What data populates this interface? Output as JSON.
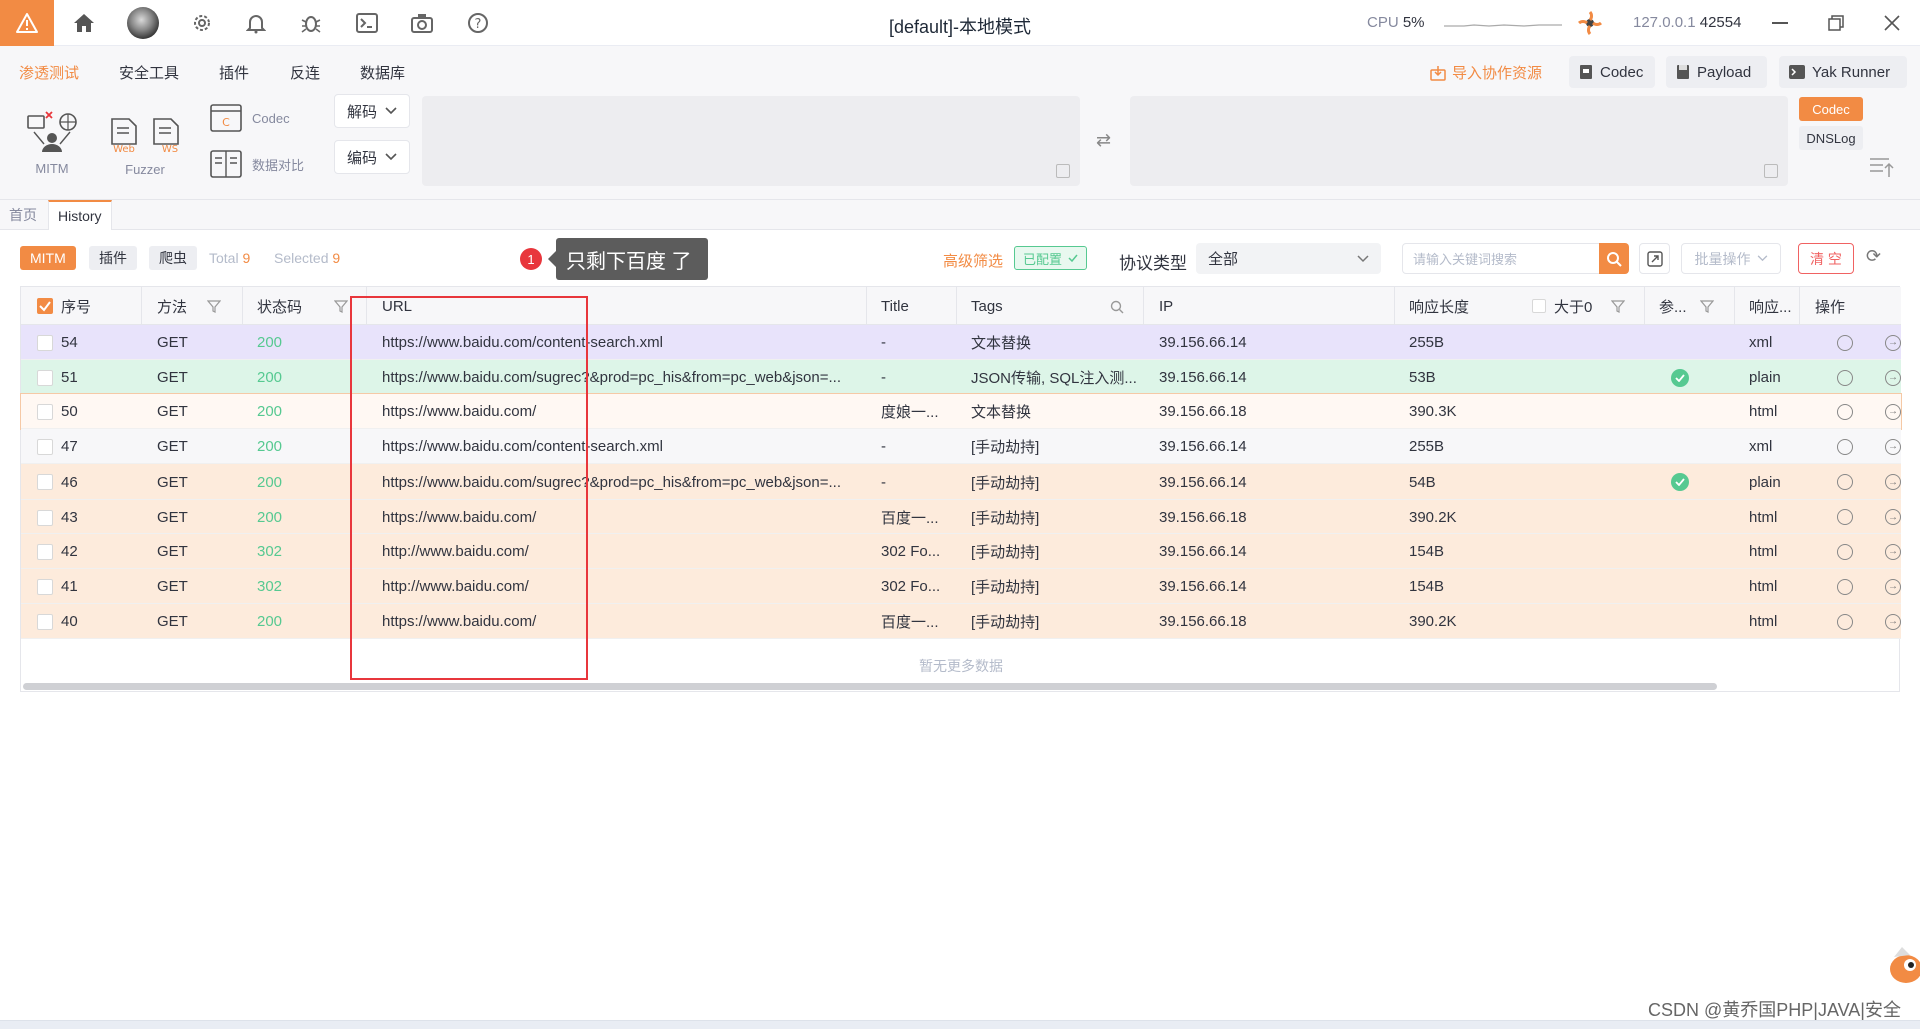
{
  "window": {
    "title": "[default]-本地模式",
    "cpu_label": "CPU",
    "cpu_value": "5%",
    "host": "127.0.0.1",
    "port": "42554"
  },
  "menu": {
    "items": [
      "渗透测试",
      "安全工具",
      "插件",
      "反连",
      "数据库"
    ],
    "active_index": 0,
    "import_label": "导入协作资源",
    "right_buttons": [
      "Codec",
      "Payload",
      "Yak Runner"
    ]
  },
  "toolbar": {
    "mitm_label": "MITM",
    "fuzzer_label": "Fuzzer",
    "fuzzer_web": "Web",
    "fuzzer_ws": "WS",
    "codec_label": "Codec",
    "diff_label": "数据对比",
    "decode_label": "解码",
    "encode_label": "编码",
    "side_codec": "Codec",
    "side_dnslog": "DNSLog"
  },
  "tabs": [
    "首页",
    "History"
  ],
  "filter": {
    "chips": [
      "MITM",
      "插件",
      "爬虫"
    ],
    "total_label": "Total",
    "total_value": "9",
    "selected_label": "Selected",
    "selected_value": "9",
    "annotation_number": "1",
    "annotation_text": "只剩下百度 了",
    "advanced_label": "高级筛选",
    "configured_label": "已配置",
    "protocol_label": "协议类型",
    "protocol_value": "全部",
    "search_placeholder": "请输入关键词搜索",
    "batch_label": "批量操作",
    "clear_label": "清 空"
  },
  "table": {
    "headers": [
      "序号",
      "方法",
      "状态码",
      "URL",
      "Title",
      "Tags",
      "IP",
      "响应长度",
      "大于0",
      "参...",
      "响应...",
      "操作"
    ],
    "rows": [
      {
        "id": "54",
        "method": "GET",
        "status": "200",
        "url": "https://www.baidu.com/content-search.xml",
        "title": "-",
        "tags": "文本替换",
        "ip": "39.156.66.14",
        "length": "255B",
        "param": false,
        "type": "xml"
      },
      {
        "id": "51",
        "method": "GET",
        "status": "200",
        "url": "https://www.baidu.com/sugrec?&prod=pc_his&from=pc_web&json=...",
        "title": "-",
        "tags": "JSON传输, SQL注入测...",
        "ip": "39.156.66.14",
        "length": "53B",
        "param": true,
        "type": "plain"
      },
      {
        "id": "50",
        "method": "GET",
        "status": "200",
        "url": "https://www.baidu.com/",
        "title": "度娘一...",
        "tags": "文本替换",
        "ip": "39.156.66.18",
        "length": "390.3K",
        "param": false,
        "type": "html"
      },
      {
        "id": "47",
        "method": "GET",
        "status": "200",
        "url": "https://www.baidu.com/content-search.xml",
        "title": "-",
        "tags": "[手动劫持]",
        "ip": "39.156.66.14",
        "length": "255B",
        "param": false,
        "type": "xml"
      },
      {
        "id": "46",
        "method": "GET",
        "status": "200",
        "url": "https://www.baidu.com/sugrec?&prod=pc_his&from=pc_web&json=...",
        "title": "-",
        "tags": "[手动劫持]",
        "ip": "39.156.66.14",
        "length": "54B",
        "param": true,
        "type": "plain"
      },
      {
        "id": "43",
        "method": "GET",
        "status": "200",
        "url": "https://www.baidu.com/",
        "title": "百度一...",
        "tags": "[手动劫持]",
        "ip": "39.156.66.18",
        "length": "390.2K",
        "param": false,
        "type": "html"
      },
      {
        "id": "42",
        "method": "GET",
        "status": "302",
        "url": "http://www.baidu.com/",
        "title": "302 Fo...",
        "tags": "[手动劫持]",
        "ip": "39.156.66.14",
        "length": "154B",
        "param": false,
        "type": "html"
      },
      {
        "id": "41",
        "method": "GET",
        "status": "302",
        "url": "http://www.baidu.com/",
        "title": "302 Fo...",
        "tags": "[手动劫持]",
        "ip": "39.156.66.14",
        "length": "154B",
        "param": false,
        "type": "html"
      },
      {
        "id": "40",
        "method": "GET",
        "status": "200",
        "url": "https://www.baidu.com/",
        "title": "百度一...",
        "tags": "[手动劫持]",
        "ip": "39.156.66.18",
        "length": "390.2K",
        "param": false,
        "type": "html"
      }
    ],
    "row_colors": [
      "#e8e3fb",
      "#ddf5e8",
      "#fff8f3",
      "#f7f7f9",
      "#fdebdc",
      "#fdebdc",
      "#fdebdc",
      "#fdebdc",
      "#fdebdc"
    ],
    "no_more": "暂无更多数据"
  },
  "colors": {
    "accent": "#f28b44",
    "success": "#56c991",
    "danger": "#e8363c"
  },
  "watermark": "CSDN @黄乔国PHP|JAVA|安全"
}
